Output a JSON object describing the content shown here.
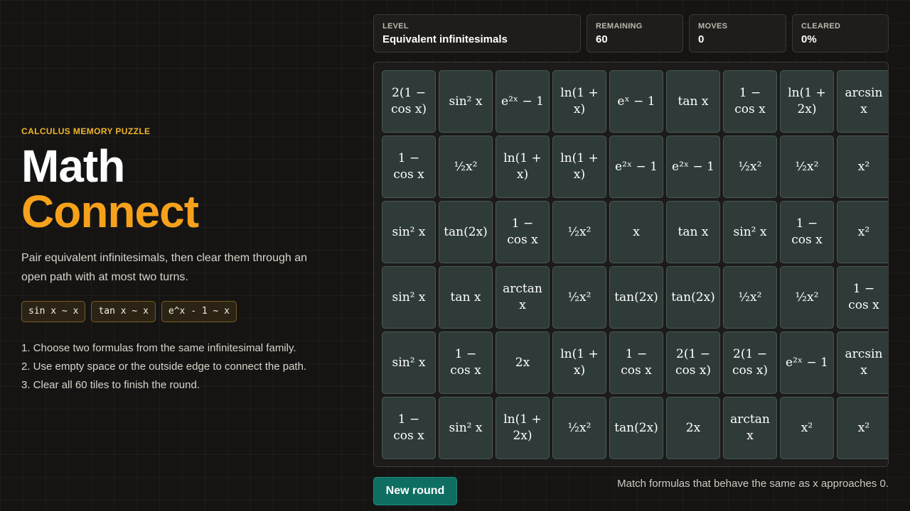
{
  "intro": {
    "eyebrow": "CALCULUS MEMORY PUZZLE",
    "title_line1": "Math",
    "title_line2": "Connect",
    "description": "Pair equivalent infinitesimals, then clear them through an open path with at most two turns.",
    "chips": [
      "sin x ~ x",
      "tan x ~ x",
      "e^x - 1 ~ x"
    ],
    "steps": [
      "1. Choose two formulas from the same infinitesimal family.",
      "2. Use empty space or the outside edge to connect the path.",
      "3. Clear all 60 tiles to finish the round."
    ]
  },
  "stats": {
    "level_label": "LEVEL",
    "level_value": "Equivalent infinitesimals",
    "remaining_label": "REMAINING",
    "remaining_value": "60",
    "moves_label": "MOVES",
    "moves_value": "0",
    "cleared_label": "CLEARED",
    "cleared_value": "0%"
  },
  "board": {
    "rows": [
      [
        "2(1 −\ncos x)",
        "sin² x",
        "e²ˣ − 1",
        "ln(1 +\nx)",
        "eˣ − 1",
        "tan x",
        "1 −\ncos x",
        "ln(1 +\n2x)",
        "arcsin x"
      ],
      [
        "1 −\ncos x",
        "½x²",
        "ln(1 +\nx)",
        "ln(1 +\nx)",
        "e²ˣ − 1",
        "e²ˣ − 1",
        "½x²",
        "½x²",
        "x²"
      ],
      [
        "sin² x",
        "tan(2x)",
        "1 −\ncos x",
        "½x²",
        "x",
        "tan x",
        "sin² x",
        "1 −\ncos x",
        "x²"
      ],
      [
        "sin² x",
        "tan x",
        "arctan x",
        "½x²",
        "tan(2x)",
        "tan(2x)",
        "½x²",
        "½x²",
        "1 −\ncos x"
      ],
      [
        "sin² x",
        "1 −\ncos x",
        "2x",
        "ln(1 +\nx)",
        "1 −\ncos x",
        "2(1 −\ncos x)",
        "2(1 −\ncos x)",
        "e²ˣ − 1",
        "arcsin x"
      ],
      [
        "1 −\ncos x",
        "sin² x",
        "ln(1 +\n2x)",
        "½x²",
        "tan(2x)",
        "2x",
        "arctan x",
        "x²",
        "x²"
      ]
    ]
  },
  "footer": {
    "new_round_label": "New round",
    "hint": "Match formulas that behave the same as x approaches 0."
  }
}
